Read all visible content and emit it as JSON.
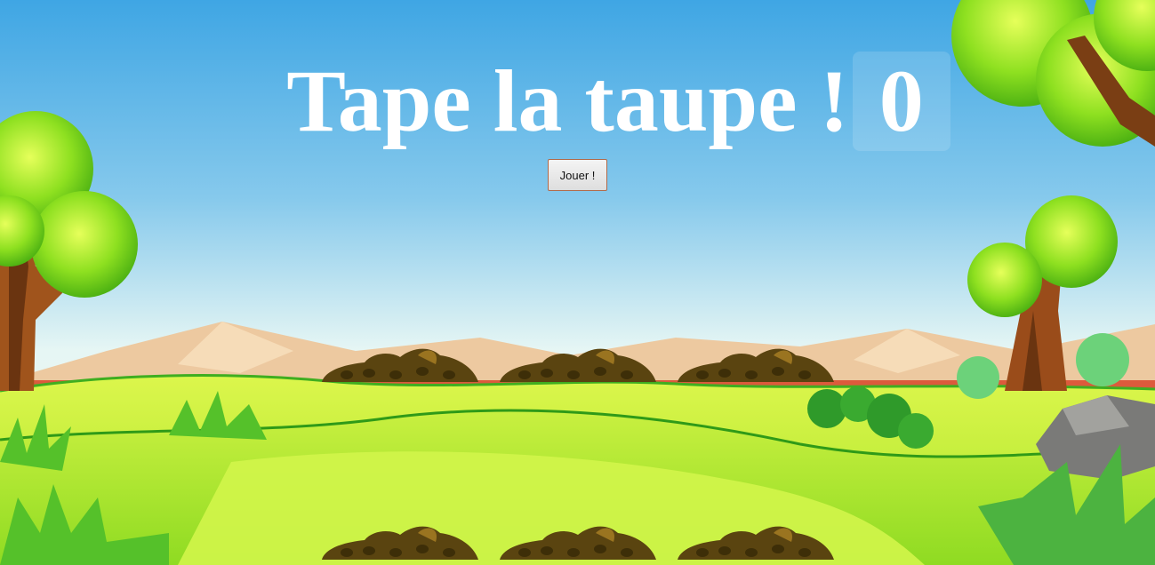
{
  "game": {
    "title": "Tape la taupe !",
    "score": "0",
    "play_label": "Jouer !"
  },
  "colors": {
    "sky_top": "#3fa6e4",
    "sky_bottom": "#e8f7f4",
    "mountains": "#edc9a0",
    "grass": "#c8ef3a",
    "grass_dark": "#7fd21c",
    "dirt": "#5a4410",
    "title_text": "#ffffff"
  },
  "mole_holes": [
    {
      "row": "top",
      "col": 1
    },
    {
      "row": "top",
      "col": 2
    },
    {
      "row": "top",
      "col": 3
    },
    {
      "row": "bottom",
      "col": 1
    },
    {
      "row": "bottom",
      "col": 2
    },
    {
      "row": "bottom",
      "col": 3
    }
  ]
}
